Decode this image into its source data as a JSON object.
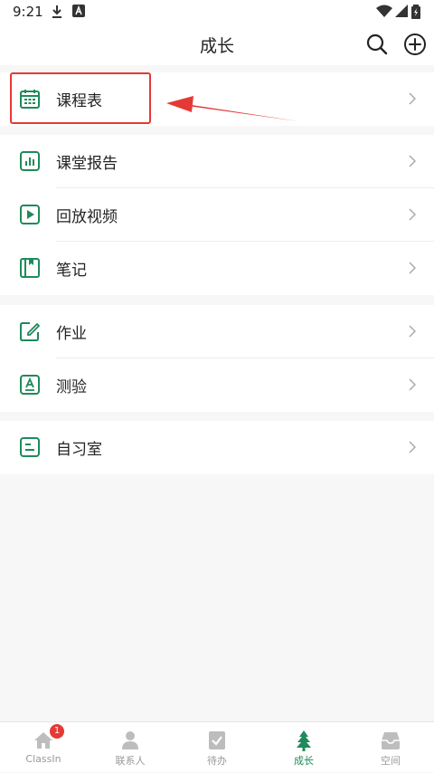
{
  "status_bar": {
    "time": "9:21"
  },
  "header": {
    "title": "成长"
  },
  "sections": [
    {
      "items": [
        {
          "label": "课程表",
          "icon": "calendar-icon"
        }
      ]
    },
    {
      "items": [
        {
          "label": "课堂报告",
          "icon": "report-chart-icon"
        },
        {
          "label": "回放视频",
          "icon": "play-video-icon"
        },
        {
          "label": "笔记",
          "icon": "notebook-icon"
        }
      ]
    },
    {
      "items": [
        {
          "label": "作业",
          "icon": "edit-homework-icon"
        },
        {
          "label": "测验",
          "icon": "quiz-icon"
        }
      ]
    },
    {
      "items": [
        {
          "label": "自习室",
          "icon": "study-room-icon"
        }
      ]
    }
  ],
  "tab_bar": {
    "tabs": [
      {
        "label": "ClassIn",
        "badge": "1",
        "icon": "home-icon"
      },
      {
        "label": "联系人",
        "icon": "contacts-icon"
      },
      {
        "label": "待办",
        "icon": "todo-icon"
      },
      {
        "label": "成长",
        "icon": "tree-icon",
        "active": true
      },
      {
        "label": "空间",
        "icon": "inbox-icon"
      }
    ]
  },
  "colors": {
    "accent": "#1f8a5b",
    "highlight": "#e53935",
    "inactive": "#9a9a9a"
  }
}
